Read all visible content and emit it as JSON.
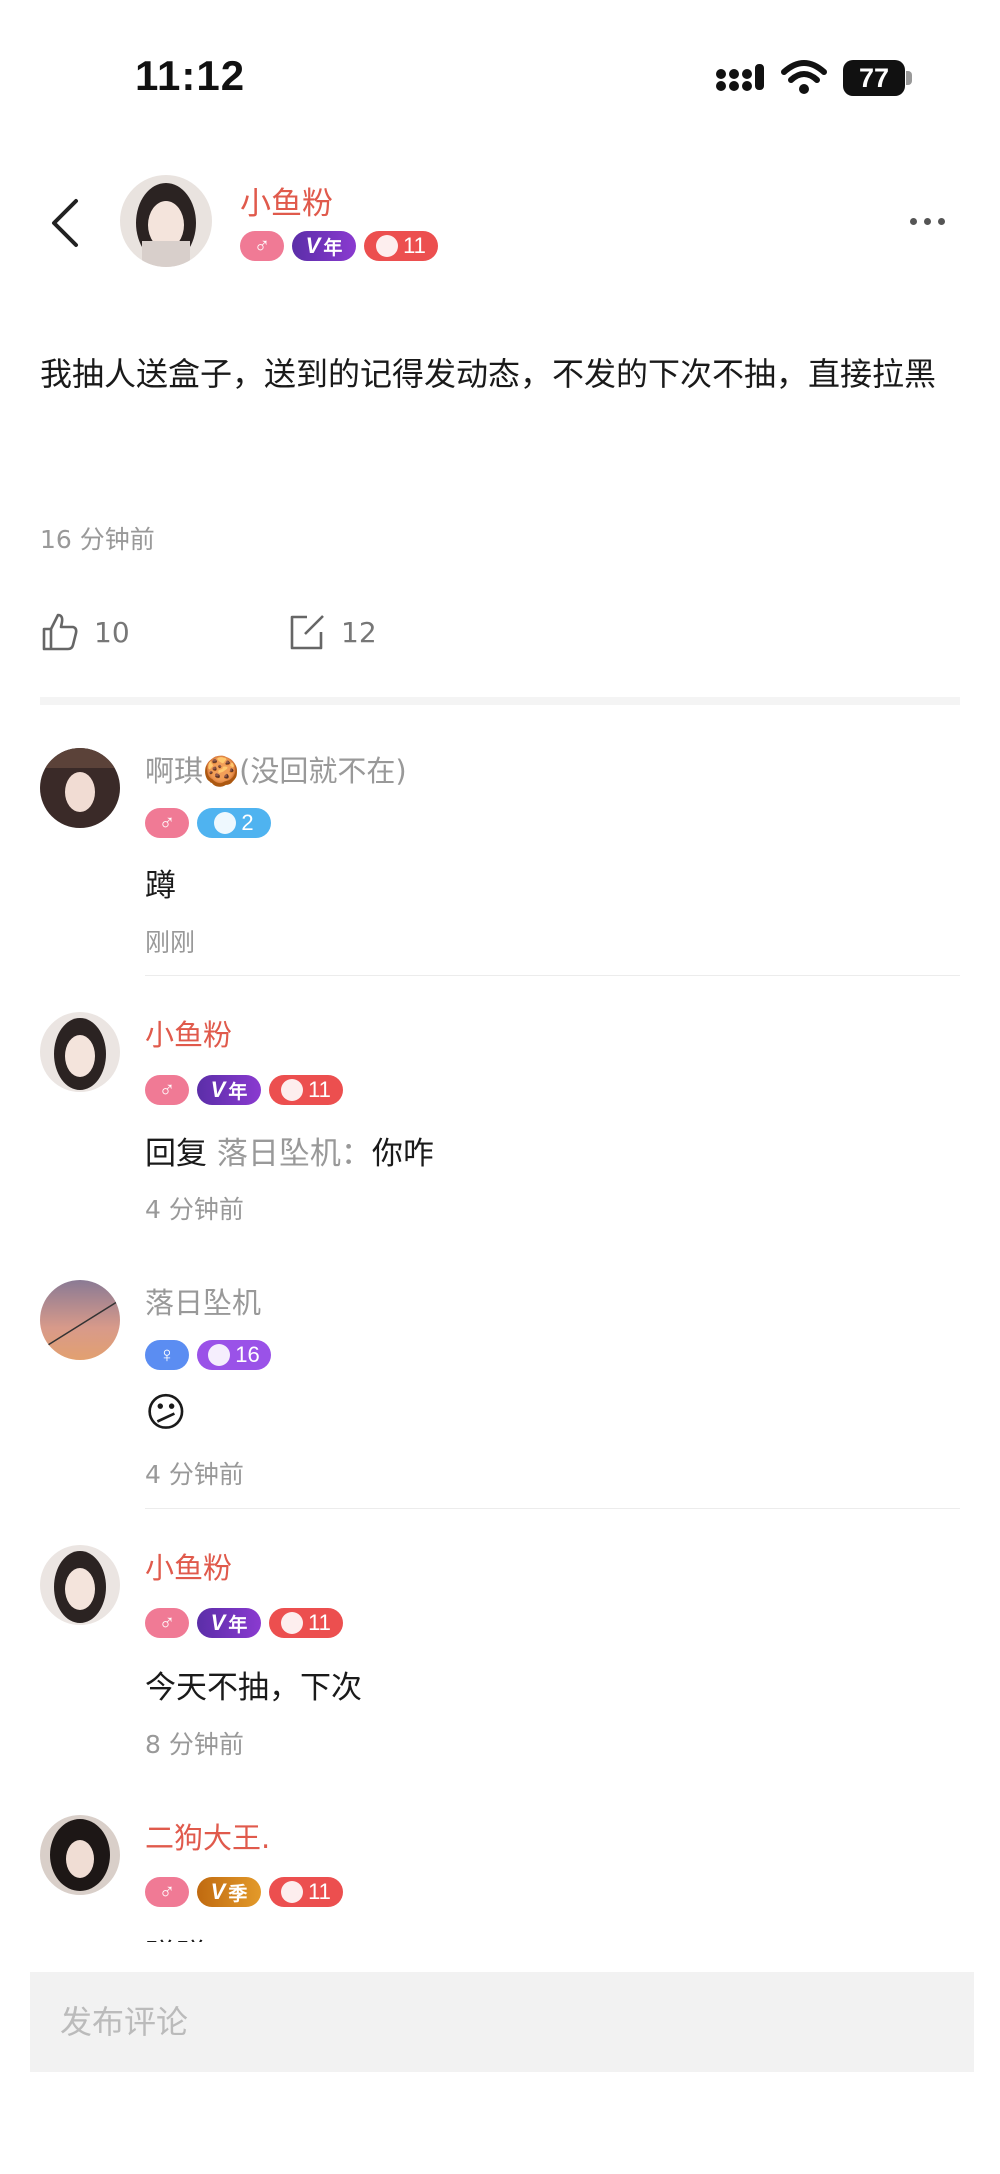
{
  "status_bar": {
    "time": "11:12",
    "battery": "77"
  },
  "post": {
    "author": "小鱼粉",
    "badges": {
      "vip_label": "V",
      "vip_sub": "年",
      "level": "11"
    },
    "content": "我抽人送盒子，送到的记得发动态，不发的下次不抽，直接拉黑",
    "time": "16 分钟前",
    "likes": "10",
    "comments": "12"
  },
  "comments": [
    {
      "name": "啊琪🍪(没回就不在)",
      "gender": "male",
      "level_badge": "2",
      "text": "蹲",
      "time": "刚刚"
    },
    {
      "name": "小鱼粉",
      "gender": "male",
      "vip": "年",
      "level_badge": "11",
      "reply_prefix": "回复",
      "reply_to": "落日坠机",
      "reply_sep": "：",
      "text": "你咋",
      "time": "4 分钟前"
    },
    {
      "name": "落日坠机",
      "gender": "female",
      "level_badge": "16",
      "text": "😕",
      "time": "4 分钟前"
    },
    {
      "name": "小鱼粉",
      "gender": "male",
      "vip": "年",
      "level_badge": "11",
      "text": "今天不抽，下次",
      "time": "8 分钟前"
    },
    {
      "name": "二狗大王.",
      "gender": "male",
      "vip": "季",
      "level_badge": "11",
      "text": "蹭蹭",
      "time": ""
    }
  ],
  "input": {
    "placeholder": "发布评论"
  },
  "colors": {
    "accent_name": "#e05a4c",
    "muted": "#999999",
    "heart_badge": "#ec4f4f",
    "vip_badge": "#6b34bf"
  }
}
